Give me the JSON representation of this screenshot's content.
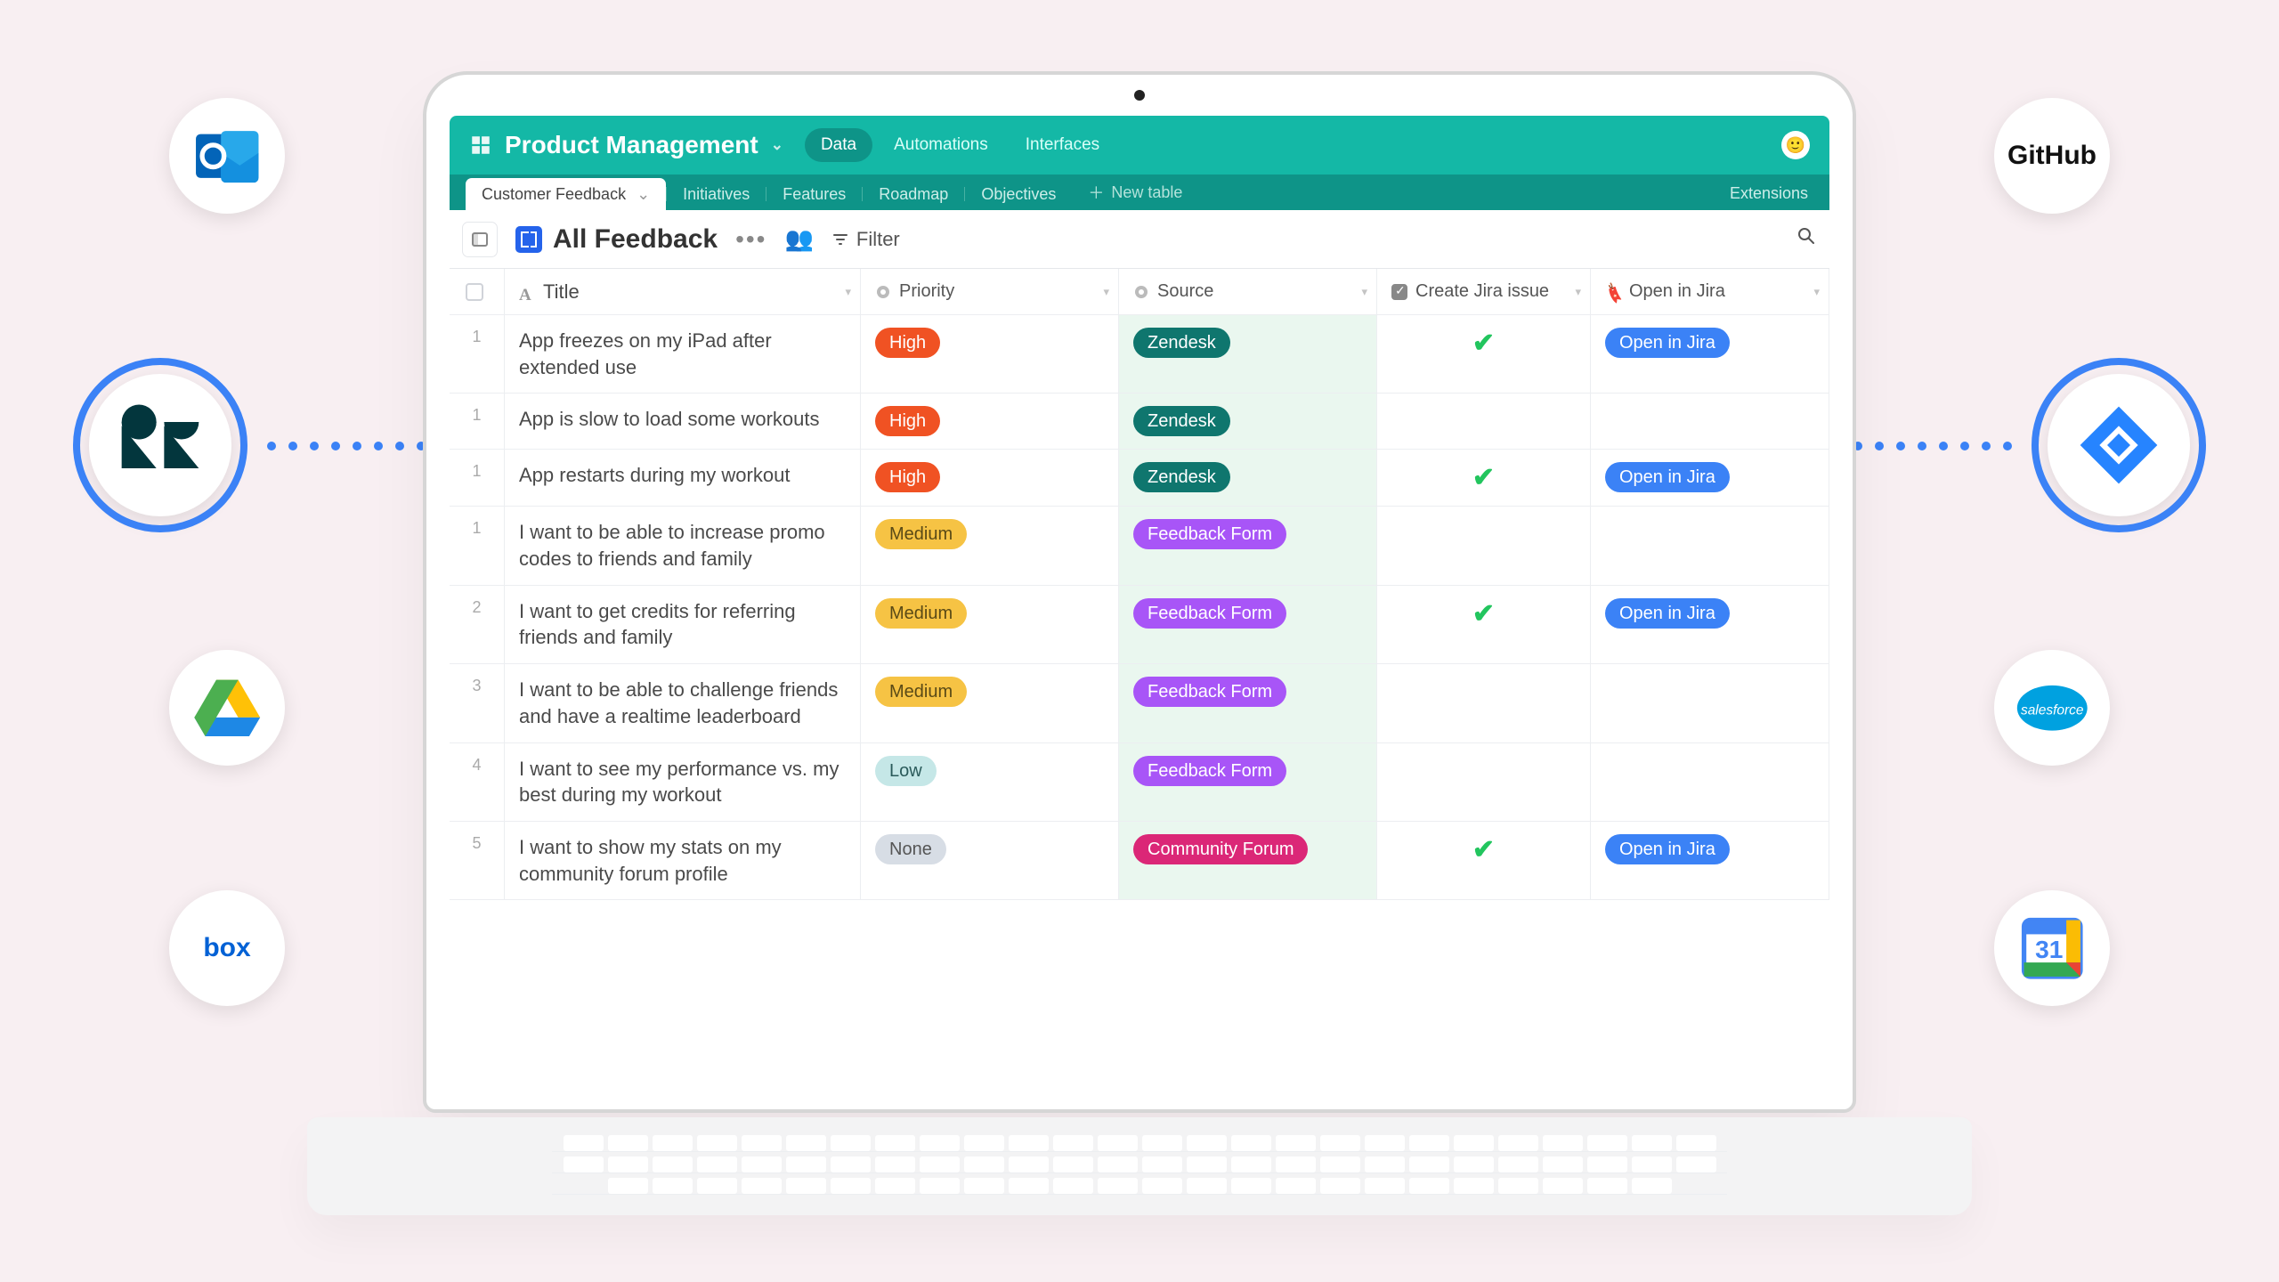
{
  "side_icons": {
    "left": [
      "outlook",
      "zendesk",
      "google-drive",
      "box"
    ],
    "right": [
      "github",
      "jira",
      "salesforce",
      "google-calendar"
    ]
  },
  "labels": {
    "github": "GitHub",
    "salesforce": "salesforce",
    "box": "box",
    "gcal_day": "31"
  },
  "header": {
    "workspace": "Product Management",
    "tabs": [
      "Data",
      "Automations",
      "Interfaces"
    ],
    "active_tab": 0
  },
  "tables": {
    "items": [
      "Customer Feedback",
      "Initiatives",
      "Features",
      "Roadmap",
      "Objectives"
    ],
    "active": 0,
    "new": "New table",
    "ext": "Extensions"
  },
  "view": {
    "name": "All Feedback",
    "filter": "Filter"
  },
  "columns": [
    "Title",
    "Priority",
    "Source",
    "Create Jira issue",
    "Open in Jira"
  ],
  "open_label": "Open in Jira",
  "rows": [
    {
      "n": "1",
      "title": "App freezes on my iPad after extended use",
      "prio": "High",
      "prio_cls": "high",
      "src": "Zendesk",
      "src_cls": "zendesk",
      "chk": true,
      "open": true
    },
    {
      "n": "1",
      "title": "App is slow to load some workouts",
      "prio": "High",
      "prio_cls": "high",
      "src": "Zendesk",
      "src_cls": "zendesk",
      "chk": false,
      "open": false
    },
    {
      "n": "1",
      "title": "App restarts during my workout",
      "prio": "High",
      "prio_cls": "high",
      "src": "Zendesk",
      "src_cls": "zendesk",
      "chk": true,
      "open": true
    },
    {
      "n": "1",
      "title": "I want to be able to increase promo codes to friends and family",
      "prio": "Medium",
      "prio_cls": "medium",
      "src": "Feedback Form",
      "src_cls": "form",
      "chk": false,
      "open": false
    },
    {
      "n": "2",
      "title": "I want to get credits for referring friends and family",
      "prio": "Medium",
      "prio_cls": "medium",
      "src": "Feedback Form",
      "src_cls": "form",
      "chk": true,
      "open": true
    },
    {
      "n": "3",
      "title": "I want to be able to challenge friends and have a realtime leaderboard",
      "prio": "Medium",
      "prio_cls": "medium",
      "src": "Feedback Form",
      "src_cls": "form",
      "chk": false,
      "open": false
    },
    {
      "n": "4",
      "title": "I want to see my performance vs. my best during my workout",
      "prio": "Low",
      "prio_cls": "low",
      "src": "Feedback Form",
      "src_cls": "form",
      "chk": false,
      "open": false
    },
    {
      "n": "5",
      "title": "I want to show my stats on my community forum profile",
      "prio": "None",
      "prio_cls": "none",
      "src": "Community Forum",
      "src_cls": "forum",
      "chk": true,
      "open": true
    }
  ]
}
